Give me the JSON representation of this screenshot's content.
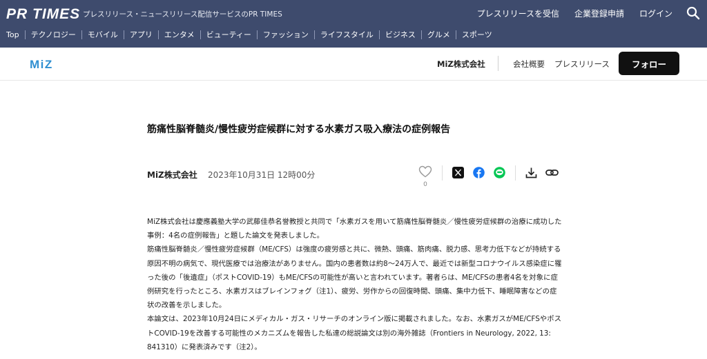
{
  "header": {
    "logo": "PR TIMES",
    "tagline": "プレスリリース・ニュースリリース配信サービスのPR TIMES",
    "links": [
      "プレスリリースを受信",
      "企業登録申請",
      "ログイン"
    ],
    "categories": [
      "Top",
      "テクノロジー",
      "モバイル",
      "アプリ",
      "エンタメ",
      "ビューティー",
      "ファッション",
      "ライフスタイル",
      "ビジネス",
      "グルメ",
      "スポーツ"
    ]
  },
  "company_bar": {
    "logo": "MiZ",
    "company_name": "MiZ株式会社",
    "about_link": "会社概要",
    "press_link": "プレスリリース",
    "follow_label": "フォロー"
  },
  "article": {
    "title": "筋痛性脳脊髄炎/慢性疲労症候群に対する水素ガス吸入療法の症例報告",
    "company": "MiZ株式会社",
    "date": "2023年10月31日 12時00分",
    "like_count": "0",
    "paragraphs": [
      "MiZ株式会社は慶應義塾大学の武藤佳恭名誉教授と共同で「水素ガスを用いて筋痛性脳脊髄炎／慢性疲労症候群の治療に成功した事例：4名の症例報告」と題した論文を発表しました。",
      "筋痛性脳脊髄炎／慢性疲労症候群（ME/CFS）は強度の疲労感と共に、微熱、頭痛、筋肉痛、脱力感、思考力低下などが持続する原因不明の病気で、現代医療では治療法がありません。国内の患者数は約8～24万人で、最近では新型コロナウイルス感染症に罹った後の「後遺症」（ポストCOVID-19）もME/CFSの可能性が高いと言われています。著者らは、ME/CFSの患者4名を対象に症例研究を行ったところ、水素ガスはブレインフォグ（注1）、疲労、労作からの回復時間、頭痛、集中力低下、睡眠障害などの症状の改善を示しました。",
      "本論文は、2023年10月24日にメディカル・ガス・リサーチのオンライン版に掲載されました。なお、水素ガスがME/CFSやポストCOVID-19を改善する可能性のメカニズムを報告した私達の総説論文は別の海外雑誌（Frontiers in Neurology, 2022, 13: 841310）に発表済みです（注2）。"
    ]
  }
}
